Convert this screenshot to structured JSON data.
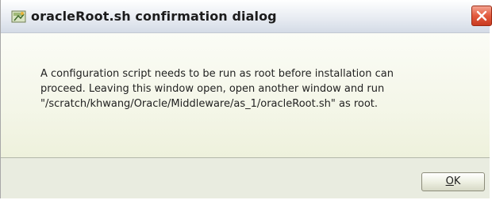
{
  "dialog": {
    "title": "oracleRoot.sh confirmation dialog",
    "title_icon": "installer-icon",
    "close_icon": "close-icon",
    "message_lines": [
      "A configuration script needs to be run as root before installation can",
      "proceed. Leaving this window open, open another window and run",
      "\"/scratch/khwang/Oracle/Middleware/as_1/oracleRoot.sh\" as root."
    ]
  },
  "buttons": {
    "ok_mnemonic": "O",
    "ok_rest": "K"
  },
  "colors": {
    "close_button": "#e25a3e",
    "content_background": "#f4f6e8"
  }
}
